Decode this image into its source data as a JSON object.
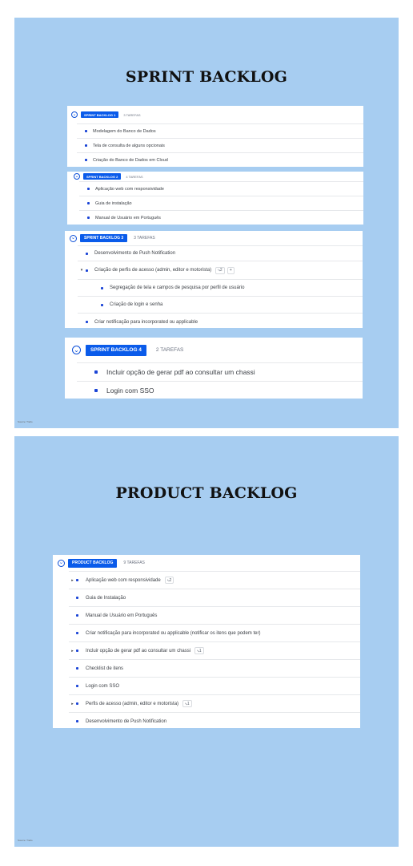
{
  "slide1": {
    "title": "SPRINT BACKLOG",
    "footer": "Source: Trello",
    "panels": [
      {
        "tag": "SPRINT BACKLOG 1",
        "count": "3 TAREFAS",
        "items": [
          "Modelagem do Banco de Dados",
          "Tela de consulta de alguns opcionais",
          "Criação do Banco de Dados em Cloud"
        ]
      },
      {
        "tag": "SPRINT BACKLOG 2",
        "count": "4 TAREFAS",
        "items": [
          "Aplicação web com responsividade",
          "Guia de instalação",
          "Manual de Usuário em Português"
        ]
      },
      {
        "tag": "SPRINT BACKLOG 3",
        "count": "3 TAREFAS",
        "items": [
          "Desenvolvimento de Push Notification",
          "Criação de perfis de acesso (admin, editor e motorista)",
          "Segregação de tela e campos de pesquisa por perfil de usuário",
          "Criação de login e senha",
          "Criar notificação para incorporated ou applicable"
        ],
        "subtask_badge": "2",
        "plus": "+"
      },
      {
        "tag": "SPRINT BACKLOG 4",
        "count": "2 TAREFAS",
        "items": [
          "Incluir opção de gerar pdf ao consultar um chassi",
          "Login com SSO"
        ]
      }
    ]
  },
  "slide2": {
    "title": "PRODUCT BACKLOG",
    "footer": "Source: Trello",
    "panel": {
      "tag": "PRODUCT BACKLOG",
      "count": "9 TAREFAS",
      "items": [
        {
          "label": "Aplicação web com responsividade",
          "expandable": true,
          "badge": "2"
        },
        {
          "label": "Guia de Instalação"
        },
        {
          "label": "Manual de Usuário em Português"
        },
        {
          "label": "Criar notificação para incorporated ou applicable (notificar os itens que podem ter)"
        },
        {
          "label": "Incluir opção de gerar pdf ao consultar um chassi",
          "expandable": true,
          "badge": "1"
        },
        {
          "label": "Checklist de itens"
        },
        {
          "label": "Login com SSO"
        },
        {
          "label": "Perfis de acesso (admin, editor e motorista)",
          "expandable": true,
          "badge": "1"
        },
        {
          "label": "Desenvolvimento de Push Notification"
        }
      ]
    }
  },
  "icons": {
    "toggle": "chevron-circle-icon",
    "caret_down": "▾",
    "caret_right": "▸",
    "subtask": "subtask-icon"
  },
  "colors": {
    "slide_bg": "#a7cdf1",
    "tag_bg": "#0a5bea",
    "dot": "#1a44d6"
  }
}
